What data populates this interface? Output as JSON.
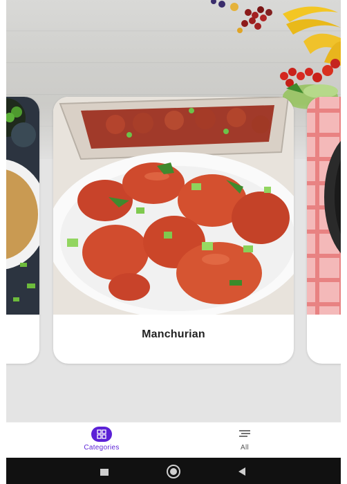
{
  "colors": {
    "accent": "#5b21d6",
    "accent_text": "#5b21d6",
    "inactive": "#555555",
    "card_bg": "#ffffff",
    "screen_bg": "#e4e4e4"
  },
  "carousel": {
    "current": {
      "title": "Manchurian",
      "image": "veg-manchurian-photo"
    },
    "previous_image": "noodles-photo",
    "next_image": "bowl-on-checkered-cloth-photo"
  },
  "bottom_nav": {
    "items": [
      {
        "label": "Categories",
        "icon": "grid-icon",
        "active": true
      },
      {
        "label": "All",
        "icon": "list-lines-icon",
        "active": false
      }
    ]
  },
  "system_nav": {
    "buttons": [
      {
        "icon": "recents-square-icon"
      },
      {
        "icon": "home-circle-icon"
      },
      {
        "icon": "back-triangle-icon"
      }
    ]
  }
}
